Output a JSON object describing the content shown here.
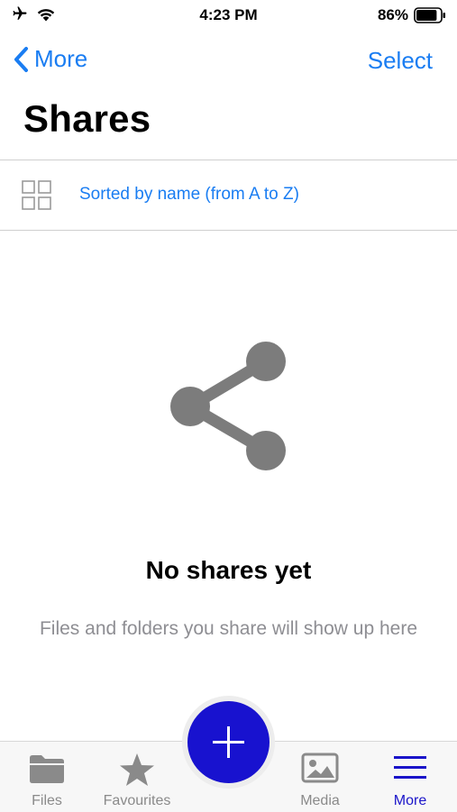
{
  "status_bar": {
    "time": "4:23 PM",
    "battery_percent": "86%",
    "battery_level": 0.86,
    "icons": [
      "airplane-icon",
      "wifi-icon",
      "battery-icon"
    ]
  },
  "nav": {
    "back_label": "More",
    "select_label": "Select",
    "title": "Shares"
  },
  "sort": {
    "label": "Sorted by name (from A to Z)",
    "icon": "grid-view-icon"
  },
  "empty_state": {
    "icon": "share-icon",
    "title": "No shares yet",
    "subtitle": "Files and folders you share will show up here"
  },
  "tab_bar": {
    "items": [
      {
        "label": "Files",
        "icon": "folder-icon",
        "active": false
      },
      {
        "label": "Favourites",
        "icon": "star-icon",
        "active": false
      },
      {
        "label": "Media",
        "icon": "image-icon",
        "active": false
      },
      {
        "label": "More",
        "icon": "menu-icon",
        "active": true
      }
    ],
    "fab_icon": "plus-icon"
  },
  "colors": {
    "accent": "#1a7df2",
    "fab": "#1812cf",
    "active_tab": "#1a14c9",
    "inactive_tab": "#8a8a8a",
    "empty_icon": "#7c7c7c"
  }
}
